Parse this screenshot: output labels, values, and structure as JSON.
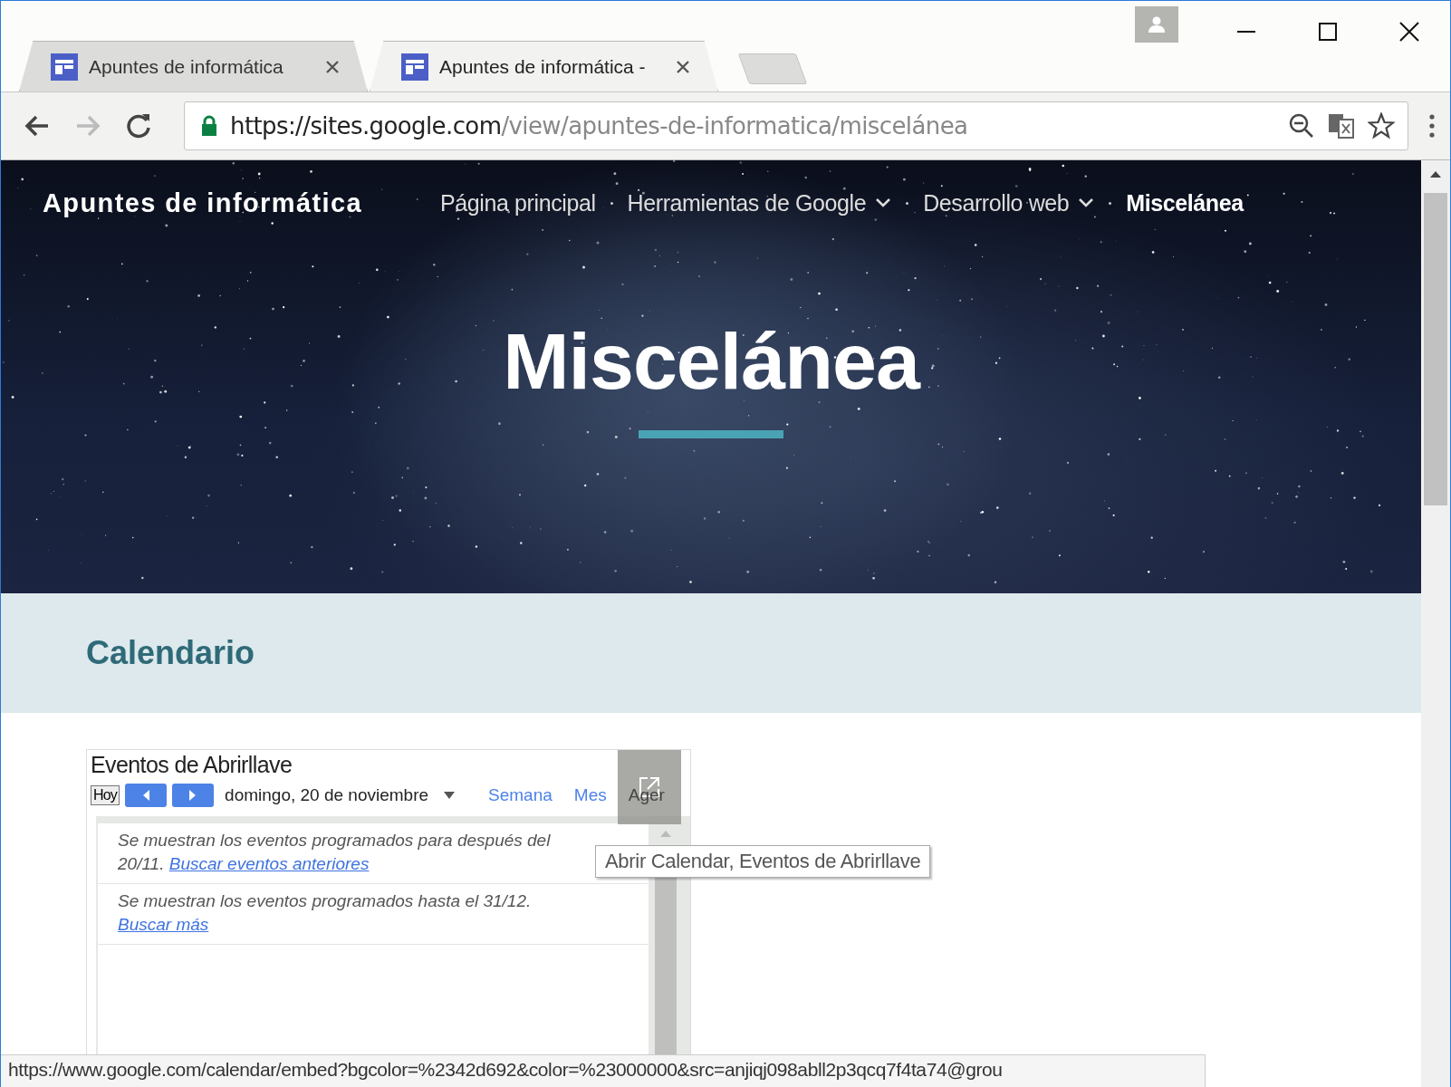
{
  "tabs": [
    {
      "title": "Apuntes de informática",
      "selected": false
    },
    {
      "title": "Apuntes de informática -",
      "selected": true
    }
  ],
  "address_bar": {
    "url_host": "https://sites.google.com",
    "url_path": "/view/apuntes-de-informatica/miscelánea"
  },
  "site": {
    "title": "Apuntes de informática",
    "nav": [
      {
        "label": "Página principal",
        "has_menu": false,
        "selected": false
      },
      {
        "label": "Herramientas de Google",
        "has_menu": true,
        "selected": false
      },
      {
        "label": "Desarrollo web",
        "has_menu": true,
        "selected": false
      },
      {
        "label": "Miscelánea",
        "has_menu": false,
        "selected": true
      }
    ]
  },
  "hero": {
    "title": "Miscelánea"
  },
  "section": {
    "title": "Calendario"
  },
  "calendar": {
    "title": "Eventos de Abrirllave",
    "today_button": "Hoy",
    "date": "domingo, 20 de noviembre",
    "views": [
      {
        "label": "Semana"
      },
      {
        "label": "Mes"
      },
      {
        "label": "Ager"
      }
    ],
    "notices": [
      {
        "text": "Se muestran los eventos programados para después del 20/11.",
        "link": "Buscar eventos anteriores",
        "link_on_new_line": false
      },
      {
        "text": "Se muestran los eventos programados hasta el 31/12.",
        "link": "Buscar más",
        "link_on_new_line": true
      }
    ]
  },
  "tooltip": "Abrir Calendar, Eventos de Abrirllave",
  "status_bar": "https://www.google.com/calendar/embed?bgcolor=%2342d692&color=%23000000&src=anjiqj098abll2p3qcq7f4ta74@grou"
}
